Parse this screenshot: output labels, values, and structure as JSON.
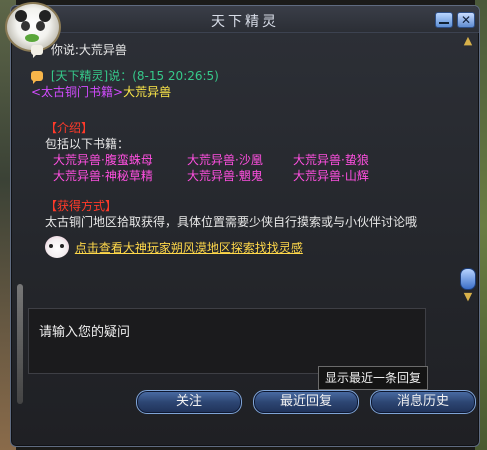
{
  "window": {
    "title": "天下精灵"
  },
  "messages": {
    "user_prefix": "你说:",
    "user_query": "大荒异兽",
    "bot_name_time": "[天下精灵]说：(8-15 20:26:5)",
    "book_tag": "<太古铜门书籍>",
    "book_title": "大荒异兽",
    "section_intro": "【介绍】",
    "intro_text": "包括以下书籍：",
    "books": [
      "大荒异兽·腹蛮蛛母",
      "大荒异兽·沙凰",
      "大荒异兽·蛰狼",
      "大荒异兽·神秘草精",
      "大荒异兽·魍鬼",
      "大荒异兽·山辉"
    ],
    "section_obtain": "【获得方式】",
    "obtain_text": "太古铜门地区拾取获得，具体位置需要少侠自行摸索或与小伙伴讨论哦",
    "guide_link": "点击查看大神玩家朔风漠地区探索找找灵感"
  },
  "input": {
    "placeholder": "请输入您的疑问"
  },
  "tooltip": "显示最近一条回复",
  "buttons": {
    "follow": "关注",
    "recent_reply": "最近回复",
    "history": "消息历史"
  }
}
